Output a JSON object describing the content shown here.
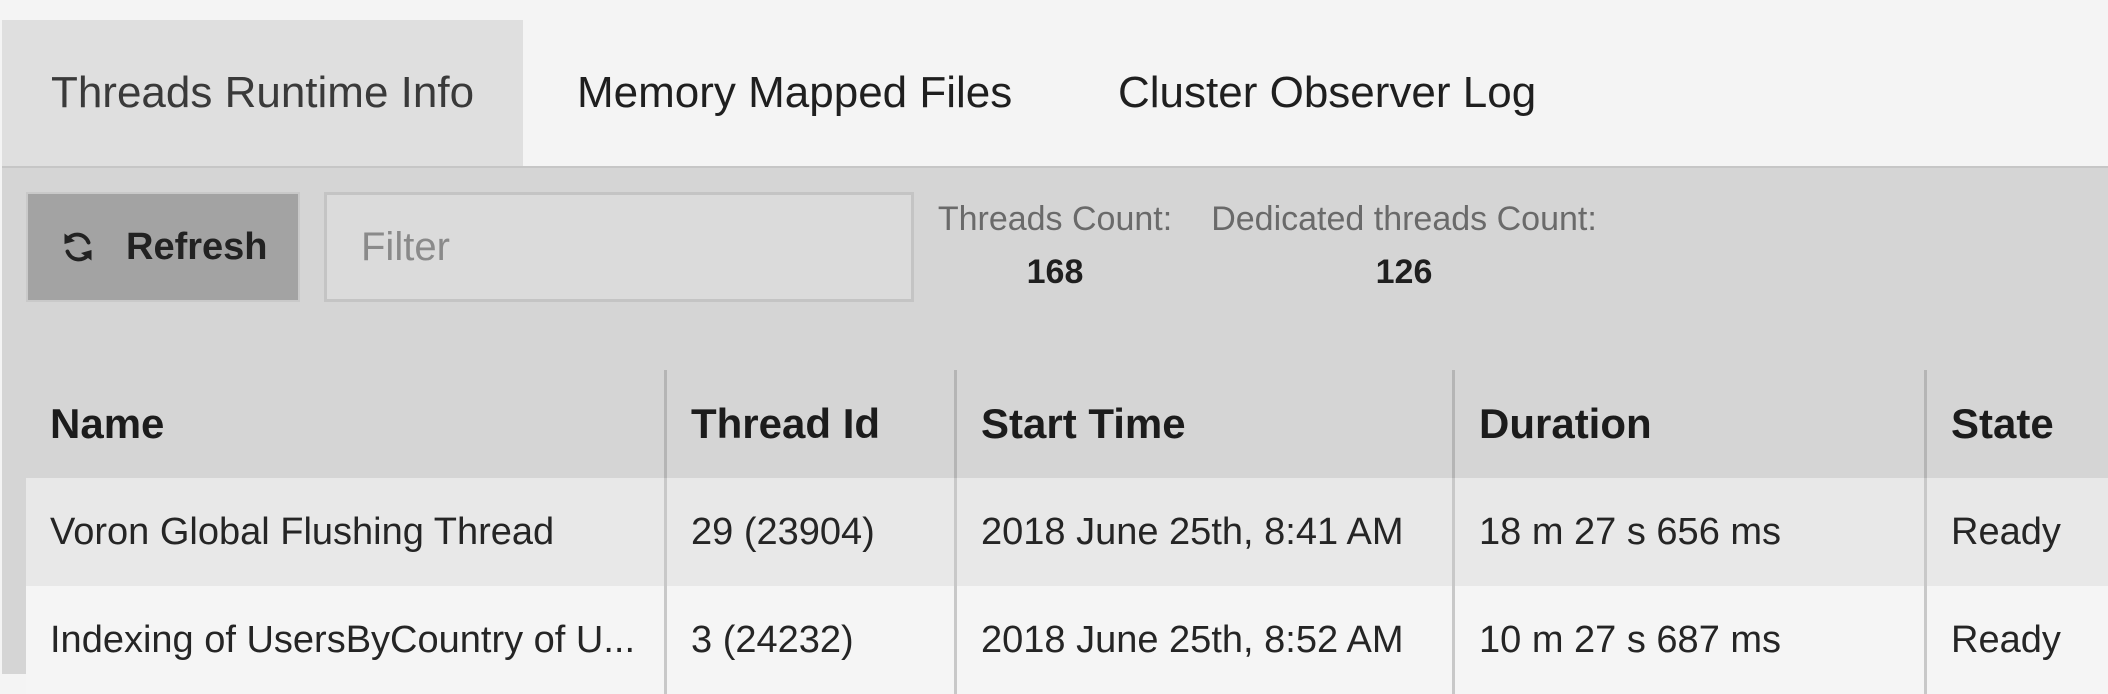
{
  "tabs": [
    {
      "label": "Threads Runtime Info",
      "active": true
    },
    {
      "label": "Memory Mapped Files",
      "active": false
    },
    {
      "label": "Cluster Observer Log",
      "active": false
    }
  ],
  "toolbar": {
    "refresh_label": "Refresh",
    "refresh_icon": "refresh-icon",
    "filter_placeholder": "Filter",
    "filter_value": ""
  },
  "stats": {
    "threads_count_label": "Threads Count:",
    "threads_count_value": "168",
    "dedicated_label": "Dedicated threads Count:",
    "dedicated_value": "126"
  },
  "table": {
    "columns": [
      "Name",
      "Thread Id",
      "Start Time",
      "Duration",
      "State"
    ],
    "rows": [
      [
        "Voron Global Flushing Thread",
        "29 (23904)",
        "2018 June 25th, 8:41 AM",
        "18 m 27 s 656 ms",
        "Ready"
      ],
      [
        "Indexing of UsersByCountry of U...",
        "3 (24232)",
        "2018 June 25th, 8:52 AM",
        "10 m 27 s 687 ms",
        "Ready"
      ]
    ]
  },
  "colors": {
    "active_tab_bg": "#dfdfdf",
    "panel_bg": "#d5d5d5",
    "button_bg": "#a3a3a3"
  }
}
